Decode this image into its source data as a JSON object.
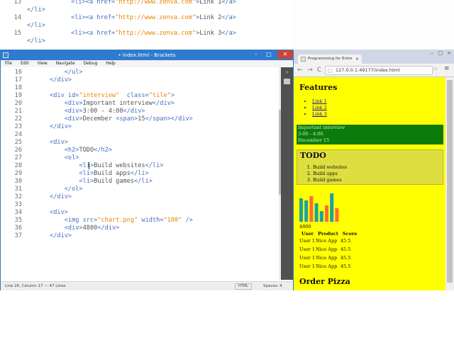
{
  "top_code": [
    {
      "ln": "13",
      "code": [
        {
          "c": "tag",
          "t": "            <li><a href="
        },
        {
          "c": "str",
          "t": "\"http://www.zenva.com\""
        },
        {
          "c": "tag",
          "t": ">"
        },
        {
          "c": "txt",
          "t": "Link 1"
        },
        {
          "c": "tag",
          "t": "</a>"
        }
      ]
    },
    {
      "ln": "",
      "code": [
        {
          "c": "tag",
          "t": "</li>"
        }
      ]
    },
    {
      "ln": "14",
      "code": [
        {
          "c": "tag",
          "t": "            <li><a href="
        },
        {
          "c": "str",
          "t": "\"http://www.zenva.com\""
        },
        {
          "c": "tag",
          "t": ">"
        },
        {
          "c": "txt",
          "t": "Link 2"
        },
        {
          "c": "tag",
          "t": "</a>"
        }
      ]
    },
    {
      "ln": "",
      "code": [
        {
          "c": "tag",
          "t": "</li>"
        }
      ]
    },
    {
      "ln": "15",
      "code": [
        {
          "c": "tag",
          "t": "            <li><a href="
        },
        {
          "c": "str",
          "t": "\"http://www.zenva.com\""
        },
        {
          "c": "tag",
          "t": ">"
        },
        {
          "c": "txt",
          "t": "Link 3"
        },
        {
          "c": "tag",
          "t": "</a>"
        }
      ]
    },
    {
      "ln": "",
      "code": [
        {
          "c": "tag",
          "t": "</li>"
        }
      ]
    }
  ],
  "brackets": {
    "title": "• index.html - Brackets",
    "menu": [
      "File",
      "Edit",
      "View",
      "Navigate",
      "Debug",
      "Help"
    ],
    "min": "–",
    "max": "□",
    "close": "✕",
    "status_position": "Line 26, Column 17 — 47 Lines",
    "status_lang": "HTML",
    "status_spaces": "Spaces: 4"
  },
  "editor_lines": [
    {
      "ln": "16",
      "code": [
        {
          "c": "tag",
          "t": "          </ul>"
        }
      ]
    },
    {
      "ln": "17",
      "code": [
        {
          "c": "tag",
          "t": "      </div>"
        }
      ]
    },
    {
      "ln": "18",
      "code": []
    },
    {
      "ln": "19",
      "code": [
        {
          "c": "tag",
          "t": "      <div id="
        },
        {
          "c": "str",
          "t": "\"interview\""
        },
        {
          "c": "tag",
          "t": "  class="
        },
        {
          "c": "str",
          "t": "\"tile\""
        },
        {
          "c": "tag",
          "t": ">"
        }
      ]
    },
    {
      "ln": "20",
      "code": [
        {
          "c": "tag",
          "t": "          <div>"
        },
        {
          "c": "txt",
          "t": "Important interview"
        },
        {
          "c": "tag",
          "t": "</div>"
        }
      ]
    },
    {
      "ln": "21",
      "code": [
        {
          "c": "tag",
          "t": "          <div>"
        },
        {
          "c": "txt",
          "t": "3:00 - 4:00"
        },
        {
          "c": "tag",
          "t": "</div>"
        }
      ]
    },
    {
      "ln": "22",
      "code": [
        {
          "c": "tag",
          "t": "          <div>"
        },
        {
          "c": "txt",
          "t": "December "
        },
        {
          "c": "tag",
          "t": "<span>"
        },
        {
          "c": "txt",
          "t": "15"
        },
        {
          "c": "tag",
          "t": "</span></div>"
        }
      ]
    },
    {
      "ln": "23",
      "code": [
        {
          "c": "tag",
          "t": "      </div>"
        }
      ]
    },
    {
      "ln": "24",
      "code": []
    },
    {
      "ln": "25",
      "code": [
        {
          "c": "tag",
          "t": "      <div>"
        }
      ]
    },
    {
      "ln": "26",
      "code": [
        {
          "c": "tag",
          "t": "          <h2>"
        },
        {
          "c": "txt",
          "t": "TODO"
        },
        {
          "c": "tag",
          "t": "</h2>"
        }
      ]
    },
    {
      "ln": "27",
      "code": [
        {
          "c": "tag",
          "t": "          <ol>"
        }
      ]
    },
    {
      "ln": "28",
      "code": [
        {
          "c": "tag",
          "t": "              <li>"
        },
        {
          "c": "txt",
          "t": "Build websites"
        },
        {
          "c": "tag",
          "t": "</li>"
        }
      ]
    },
    {
      "ln": "29",
      "code": [
        {
          "c": "tag",
          "t": "              <li>"
        },
        {
          "c": "txt",
          "t": "Build apps"
        },
        {
          "c": "tag",
          "t": "</li>"
        }
      ]
    },
    {
      "ln": "30",
      "code": [
        {
          "c": "tag",
          "t": "              <li>"
        },
        {
          "c": "txt",
          "t": "Build games"
        },
        {
          "c": "tag",
          "t": "</li>"
        }
      ]
    },
    {
      "ln": "31",
      "code": [
        {
          "c": "tag",
          "t": "          </ol>"
        }
      ]
    },
    {
      "ln": "32",
      "code": [
        {
          "c": "tag",
          "t": "      </div>"
        }
      ]
    },
    {
      "ln": "33",
      "code": []
    },
    {
      "ln": "34",
      "code": [
        {
          "c": "tag",
          "t": "      <div>"
        }
      ]
    },
    {
      "ln": "35",
      "code": [
        {
          "c": "tag",
          "t": "          <img src="
        },
        {
          "c": "str",
          "t": "\"chart.png\""
        },
        {
          "c": "tag",
          "t": " width="
        },
        {
          "c": "str",
          "t": "\"100\""
        },
        {
          "c": "tag",
          "t": " />"
        }
      ]
    },
    {
      "ln": "36",
      "code": [
        {
          "c": "tag",
          "t": "          <div>"
        },
        {
          "c": "txt",
          "t": "4800"
        },
        {
          "c": "tag",
          "t": "</div>"
        }
      ]
    },
    {
      "ln": "37",
      "code": [
        {
          "c": "tag",
          "t": "      </div>"
        }
      ]
    }
  ],
  "browser": {
    "tab_title": "Programming for Entrepr",
    "tab_close": "×",
    "url": "127.0.0.1:49177/index.html",
    "back": "←",
    "forward": "→",
    "reload": "C",
    "star": "☆",
    "menu": "≡"
  },
  "page": {
    "features_heading": "Features",
    "links": [
      "Link 1",
      "Link 2",
      "Link 3"
    ],
    "interview": [
      "Important interview",
      "3:00 - 4:00",
      "December 15"
    ],
    "todo_heading": "TODO",
    "todo_items": [
      "Build websites",
      "Build apps",
      "Build games"
    ],
    "chart_value": "4800",
    "table_headers": [
      "User",
      "Product",
      "Score"
    ],
    "table_rows": [
      [
        "User 1",
        "Nice App",
        "45.5"
      ],
      [
        "User 1",
        "Nice App",
        "45.5"
      ],
      [
        "User 1",
        "Nice App",
        "45.5"
      ],
      [
        "User 1",
        "Nice App",
        "45.5"
      ]
    ],
    "order_heading": "Order Pizza"
  },
  "chart_image": {
    "bars": [
      {
        "value": 0.78,
        "color": "#1aa3a3"
      },
      {
        "value": 0.72,
        "color": "#1aa3a3"
      },
      {
        "value": 0.86,
        "color": "#ff6a33"
      },
      {
        "value": 0.62,
        "color": "#1aa3a3"
      },
      {
        "value": 0.36,
        "color": "#1aa3a3"
      },
      {
        "value": 0.54,
        "color": "#ff6a33"
      },
      {
        "value": 0.96,
        "color": "#1aa3a3"
      },
      {
        "value": 0.46,
        "color": "#ff6a33"
      }
    ]
  },
  "colors": {
    "page_bg": "#ffff00",
    "interview_bg": "#0b7c0b",
    "todo_bg": "#dede40",
    "brackets_title": "#2e7bcf"
  }
}
